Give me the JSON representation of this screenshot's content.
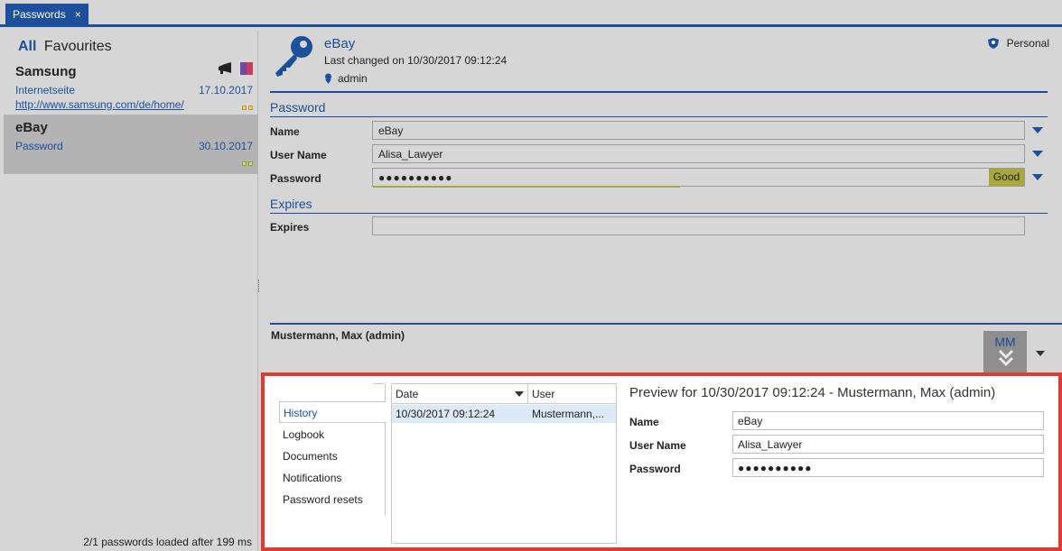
{
  "tab": {
    "label": "Passwords",
    "close": "×"
  },
  "left": {
    "filter_all": "All",
    "filter_fav": "Favourites",
    "items": [
      {
        "title": "Samsung",
        "type": "Internetseite",
        "date": "17.10.2017",
        "url": "http://www.samsung.com/de/home/"
      },
      {
        "title": "eBay",
        "type": "Password",
        "date": "30.10.2017"
      }
    ],
    "status": "2/1 passwords loaded after 199 ms"
  },
  "header": {
    "title": "eBay",
    "changed": "Last changed on 10/30/2017 09:12:24",
    "owner": "admin",
    "scope": "Personal"
  },
  "sections": {
    "password": "Password",
    "expires": "Expires"
  },
  "fields": {
    "name_label": "Name",
    "name_value": "eBay",
    "user_label": "User Name",
    "user_value": "Alisa_Lawyer",
    "password_label": "Password",
    "password_value": "●●●●●●●●●●",
    "password_strength": "Good",
    "expires_label": "Expires",
    "expires_value": ""
  },
  "user_panel": {
    "name": "Mustermann, Max (admin)",
    "initials": "MM"
  },
  "bottom": {
    "tabs": [
      "History",
      "Logbook",
      "Documents",
      "Notifications",
      "Password resets"
    ],
    "grid_headers": {
      "date": "Date",
      "user": "User"
    },
    "grid_rows": [
      {
        "date": "10/30/2017 09:12:24",
        "user": "Mustermann,..."
      }
    ],
    "preview_title": "Preview for 10/30/2017 09:12:24 - Mustermann, Max (admin)",
    "preview": {
      "name_label": "Name",
      "name_value": "eBay",
      "user_label": "User Name",
      "user_value": "Alisa_Lawyer",
      "password_label": "Password",
      "password_value": "●●●●●●●●●●"
    }
  },
  "colors": {
    "accent": "#1c4f9c",
    "highlight": "#e03a33",
    "strength": "#a8a83c"
  }
}
